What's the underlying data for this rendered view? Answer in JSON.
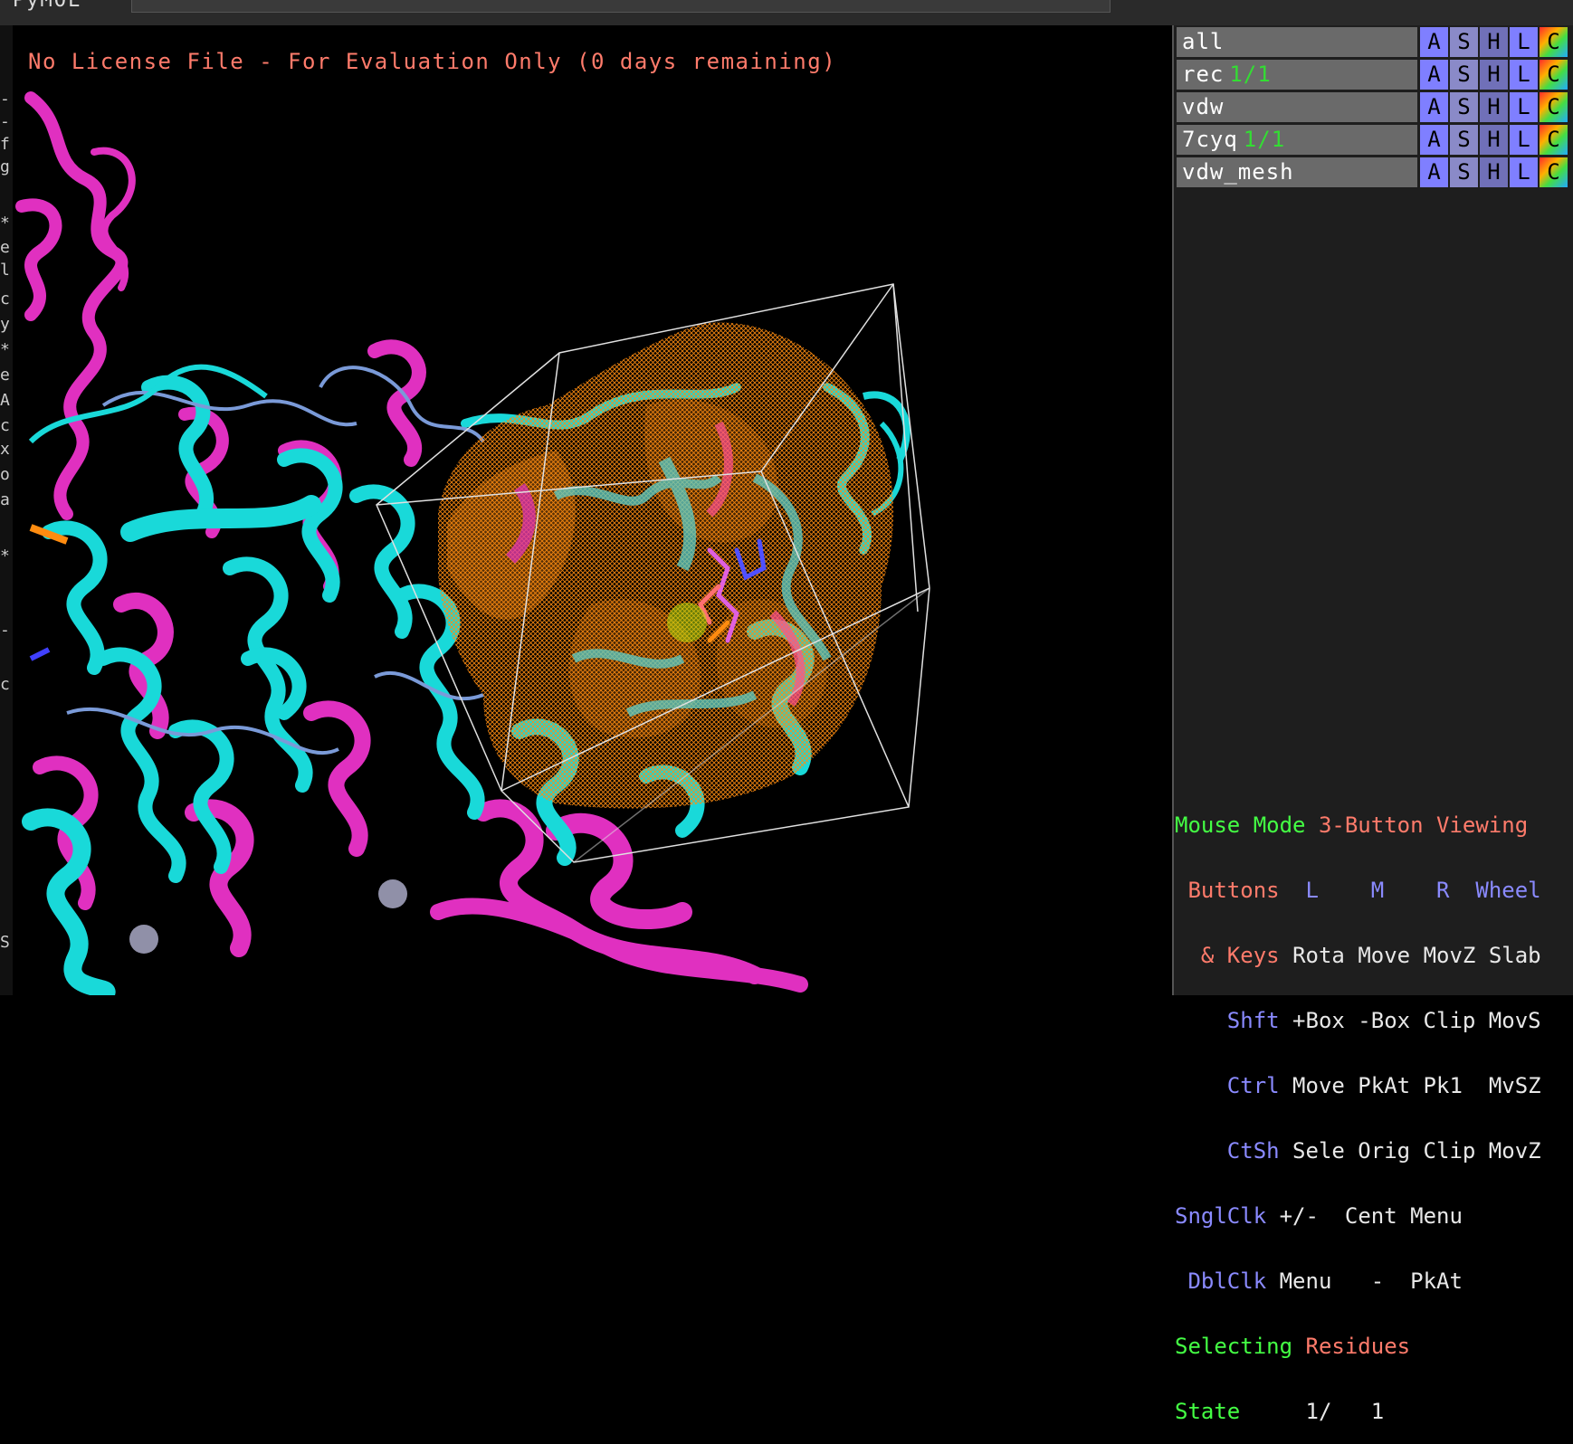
{
  "app": {
    "tab_title": "PyMOL"
  },
  "viewer": {
    "license_text": "No License File - For Evaluation Only (0 days remaining)"
  },
  "left_strip": {
    "chars": [
      "-",
      "-",
      "f",
      "g",
      "*",
      "e",
      "l",
      "c",
      "y",
      "*",
      "e",
      "A",
      "c",
      "x",
      "o",
      "a",
      "*",
      "-",
      "c",
      "S"
    ]
  },
  "objects": [
    {
      "name": "all",
      "state": "",
      "buttons": [
        "A",
        "S",
        "H",
        "L",
        "C"
      ]
    },
    {
      "name": "rec",
      "state": "1/1",
      "buttons": [
        "A",
        "S",
        "H",
        "L",
        "C"
      ]
    },
    {
      "name": "vdw",
      "state": "",
      "buttons": [
        "A",
        "S",
        "H",
        "L",
        "C"
      ]
    },
    {
      "name": "7cyq",
      "state": "1/1",
      "buttons": [
        "A",
        "S",
        "H",
        "L",
        "C"
      ]
    },
    {
      "name": "vdw_mesh",
      "state": "",
      "buttons": [
        "A",
        "S",
        "H",
        "L",
        "C"
      ]
    }
  ],
  "mouse_panel": {
    "mode_label": "Mouse Mode",
    "mode_value": "3-Button Viewing",
    "buttons_label": "Buttons",
    "button_cols": [
      "L",
      "M",
      "R",
      "Wheel"
    ],
    "keys_label": "& Keys",
    "keys_row": [
      "Rota",
      "Move",
      "MovZ",
      "Slab"
    ],
    "shft_label": "Shft",
    "shft_row": [
      "+Box",
      "-Box",
      "Clip",
      "MovS"
    ],
    "ctrl_label": "Ctrl",
    "ctrl_row": [
      "Move",
      "PkAt",
      "Pk1",
      "MvSZ"
    ],
    "ctsh_label": "CtSh",
    "ctsh_row": [
      "Sele",
      "Orig",
      "Clip",
      "MovZ"
    ],
    "sngl_label": "SnglClk",
    "sngl_row": [
      "+/-",
      "Cent",
      "Menu"
    ],
    "dbl_label": "DblClk",
    "dbl_row": [
      "Menu",
      "-",
      "PkAt"
    ],
    "selecting_label": "Selecting",
    "selecting_value": "Residues",
    "state_label": "State",
    "state_value": "1/",
    "state_total": "1"
  },
  "colors": {
    "cyan_protein": "#19d9d9",
    "magenta_protein": "#e030c0",
    "mesh": "#ff8c10",
    "box": "#e0e0e0",
    "license": "#ff7b6b"
  }
}
